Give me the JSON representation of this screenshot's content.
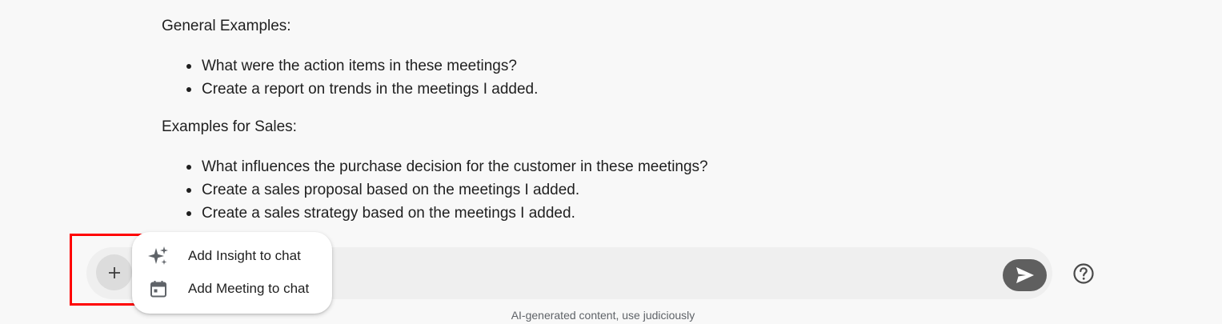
{
  "chat": {
    "general_heading": "General Examples:",
    "general_items": [
      "What were the action items in these meetings?",
      "Create a report on trends in the meetings I added."
    ],
    "sales_heading": "Examples for Sales:",
    "sales_items": [
      "What influences the purchase decision for the customer in these meetings?",
      "Create a sales proposal based on the meetings I added.",
      "Create a sales strategy based on the meetings I added."
    ]
  },
  "add_menu": {
    "items": [
      {
        "label": "Add Insight to chat",
        "icon": "sparkle-icon"
      },
      {
        "label": "Add Meeting to chat",
        "icon": "calendar-icon"
      }
    ]
  },
  "composer": {
    "plus_icon": "plus-icon",
    "send_icon": "send-icon",
    "help_icon": "help-circle-icon",
    "disclaimer": "AI-generated content, use judiciously"
  },
  "colors": {
    "background": "#f8f8f8",
    "composer": "#efefef",
    "send_button": "#5f5f5f",
    "highlight": "#ff0000"
  }
}
